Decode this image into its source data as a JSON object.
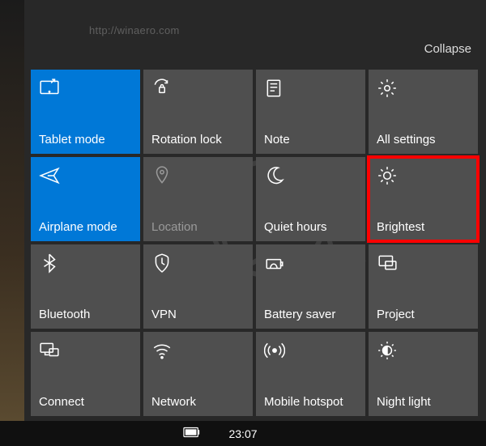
{
  "watermark": "http://winaero.com",
  "header": {
    "collapse_label": "Collapse"
  },
  "tiles": [
    {
      "label": "Tablet mode",
      "active": true
    },
    {
      "label": "Rotation lock"
    },
    {
      "label": "Note"
    },
    {
      "label": "All settings"
    },
    {
      "label": "Airplane mode",
      "active": true
    },
    {
      "label": "Location",
      "disabled": true
    },
    {
      "label": "Quiet hours"
    },
    {
      "label": "Brightest",
      "highlight": true
    },
    {
      "label": "Bluetooth"
    },
    {
      "label": "VPN"
    },
    {
      "label": "Battery saver"
    },
    {
      "label": "Project"
    },
    {
      "label": "Connect"
    },
    {
      "label": "Network"
    },
    {
      "label": "Mobile hotspot"
    },
    {
      "label": "Night light"
    }
  ],
  "taskbar": {
    "clock": "23:07"
  }
}
